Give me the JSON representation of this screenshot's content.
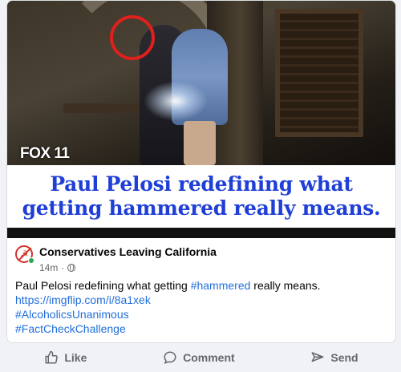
{
  "media": {
    "logo_text": "FOX 11",
    "caption": "Paul Pelosi redefining what getting hammered really means."
  },
  "post": {
    "page_name": "Conservatives Leaving California",
    "time": "14m",
    "separator": "·",
    "text_prefix": "Paul Pelosi redefining what getting ",
    "hashtag_inline": "#hammered",
    "text_suffix": " really means.",
    "link": "https://imgflip.com/i/8a1xek",
    "hashtag_1": "#AlcoholicsUnanimous",
    "hashtag_2": "#FactCheckChallenge"
  },
  "actions": {
    "like": "Like",
    "comment": "Comment",
    "send": "Send"
  },
  "colors": {
    "caption_blue": "#1f3fd6",
    "link_blue": "#216fdb",
    "circle_red": "#e0201c",
    "meta_gray": "#65676b"
  }
}
